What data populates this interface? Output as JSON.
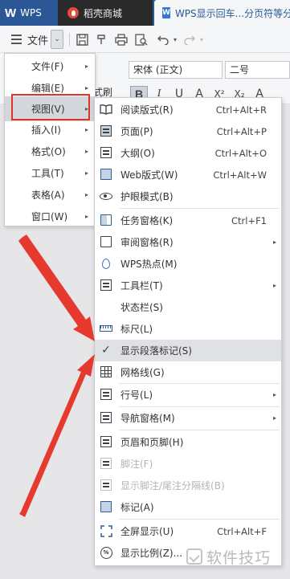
{
  "tabs": [
    {
      "label": "WPS",
      "logo": "W"
    },
    {
      "label": "稻壳商城"
    },
    {
      "label": "WPS显示回车...分页符等分"
    }
  ],
  "toolbar": {
    "file_label": "文件",
    "dropdown_glyph": "⌄"
  },
  "ribbon": {
    "font_name": "宋体 (正文)",
    "font_size": "二号",
    "format_brush_partial": "式刷",
    "bold": "B",
    "italic": "I",
    "underline": "U",
    "font_color": "A",
    "superscript": "X²",
    "subscript": "X₂",
    "clear": "A"
  },
  "left_menu": {
    "items": [
      {
        "label": "文件(F)",
        "has_submenu": true,
        "highlighted": false
      },
      {
        "label": "编辑(E)",
        "has_submenu": true,
        "highlighted": false
      },
      {
        "label": "视图(V)",
        "has_submenu": true,
        "highlighted": true
      },
      {
        "label": "插入(I)",
        "has_submenu": true,
        "highlighted": false
      },
      {
        "label": "格式(O)",
        "has_submenu": true,
        "highlighted": false
      },
      {
        "label": "工具(T)",
        "has_submenu": true,
        "highlighted": false
      },
      {
        "label": "表格(A)",
        "has_submenu": true,
        "highlighted": false
      },
      {
        "label": "窗口(W)",
        "has_submenu": true,
        "highlighted": false
      }
    ]
  },
  "view_menu": {
    "items": [
      {
        "label": "阅读版式(R)",
        "shortcut": "Ctrl+Alt+R",
        "icon": "book-icon",
        "submenu": false,
        "disabled": false,
        "highlighted": false
      },
      {
        "label": "页面(P)",
        "shortcut": "Ctrl+Alt+P",
        "icon": "page-icon",
        "submenu": false,
        "disabled": false,
        "highlighted": false
      },
      {
        "label": "大纲(O)",
        "shortcut": "Ctrl+Alt+O",
        "icon": "outline-icon",
        "submenu": false,
        "disabled": false,
        "highlighted": false
      },
      {
        "label": "Web版式(W)",
        "shortcut": "Ctrl+Alt+W",
        "icon": "web-layout-icon",
        "submenu": false,
        "disabled": false,
        "highlighted": false
      },
      {
        "label": "护眼模式(B)",
        "shortcut": "",
        "icon": "eye-icon",
        "submenu": false,
        "disabled": false,
        "highlighted": false
      },
      {
        "label": "任务窗格(K)",
        "shortcut": "Ctrl+F1",
        "icon": "task-pane-icon",
        "submenu": false,
        "disabled": false,
        "highlighted": false
      },
      {
        "label": "审阅窗格(R)",
        "shortcut": "",
        "icon": "review-pane-icon",
        "submenu": true,
        "disabled": false,
        "highlighted": false
      },
      {
        "label": "WPS热点(M)",
        "shortcut": "",
        "icon": "hotspot-icon",
        "submenu": false,
        "disabled": false,
        "highlighted": false
      },
      {
        "label": "工具栏(T)",
        "shortcut": "",
        "icon": "toolbar-icon",
        "submenu": true,
        "disabled": false,
        "highlighted": false
      },
      {
        "label": "状态栏(S)",
        "shortcut": "",
        "icon": "",
        "submenu": false,
        "disabled": false,
        "highlighted": false
      },
      {
        "label": "标尺(L)",
        "shortcut": "",
        "icon": "ruler-icon",
        "submenu": false,
        "disabled": false,
        "highlighted": false
      },
      {
        "label": "显示段落标记(S)",
        "shortcut": "",
        "icon": "check-icon",
        "submenu": false,
        "disabled": false,
        "highlighted": true
      },
      {
        "label": "网格线(G)",
        "shortcut": "",
        "icon": "grid-icon",
        "submenu": false,
        "disabled": false,
        "highlighted": false
      },
      {
        "label": "行号(L)",
        "shortcut": "",
        "icon": "line-number-icon",
        "submenu": true,
        "disabled": false,
        "highlighted": false
      },
      {
        "label": "导航窗格(M)",
        "shortcut": "",
        "icon": "navigation-pane-icon",
        "submenu": true,
        "disabled": false,
        "highlighted": false
      },
      {
        "label": "页眉和页脚(H)",
        "shortcut": "",
        "icon": "header-footer-icon",
        "submenu": false,
        "disabled": false,
        "highlighted": false
      },
      {
        "label": "脚注(F)",
        "shortcut": "",
        "icon": "footnote-icon",
        "submenu": false,
        "disabled": true,
        "highlighted": false
      },
      {
        "label": "显示脚注/尾注分隔线(B)",
        "shortcut": "",
        "icon": "footnote-separator-icon",
        "submenu": false,
        "disabled": true,
        "highlighted": false
      },
      {
        "label": "标记(A)",
        "shortcut": "",
        "icon": "markup-icon",
        "submenu": false,
        "disabled": false,
        "highlighted": false
      },
      {
        "label": "全屏显示(U)",
        "shortcut": "Ctrl+Alt+F",
        "icon": "fullscreen-icon",
        "submenu": false,
        "disabled": false,
        "highlighted": false
      },
      {
        "label": "显示比例(Z)...",
        "shortcut": "",
        "icon": "zoom-icon",
        "submenu": false,
        "disabled": false,
        "highlighted": false
      }
    ]
  },
  "watermark": {
    "text": "软件技巧"
  },
  "colors": {
    "tabbar": "#2b5797",
    "annotation_red": "#d9352a",
    "menu_highlight": "#dfe1e5"
  }
}
